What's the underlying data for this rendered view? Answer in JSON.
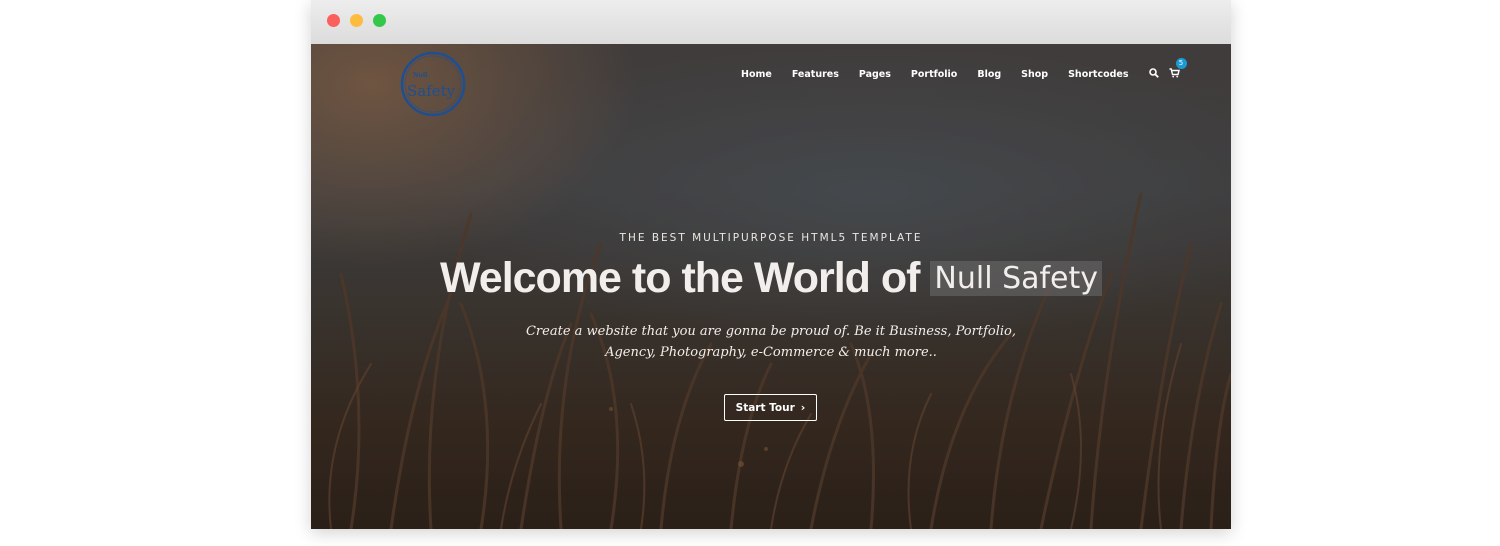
{
  "window": {
    "controls": [
      "close",
      "minimize",
      "maximize"
    ]
  },
  "logo": {
    "small_text": "Null",
    "main_text": "Safety"
  },
  "nav": {
    "items": [
      "Home",
      "Features",
      "Pages",
      "Portfolio",
      "Blog",
      "Shop",
      "Shortcodes"
    ],
    "search_icon": "search-icon",
    "cart_icon": "cart-icon",
    "cart_count": "5"
  },
  "hero": {
    "tagline": "THE BEST MULTIPURPOSE HTML5 TEMPLATE",
    "headline": "Welcome to the World of",
    "brand": "Null Safety",
    "sub_line1": "Create a website that you are gonna be proud of. Be it Business, Portfolio,",
    "sub_line2": "Agency, Photography, e-Commerce & much more..",
    "cta_label": "Start Tour"
  },
  "colors": {
    "accent": "#1a9bd7",
    "logo": "#1d4f92"
  }
}
